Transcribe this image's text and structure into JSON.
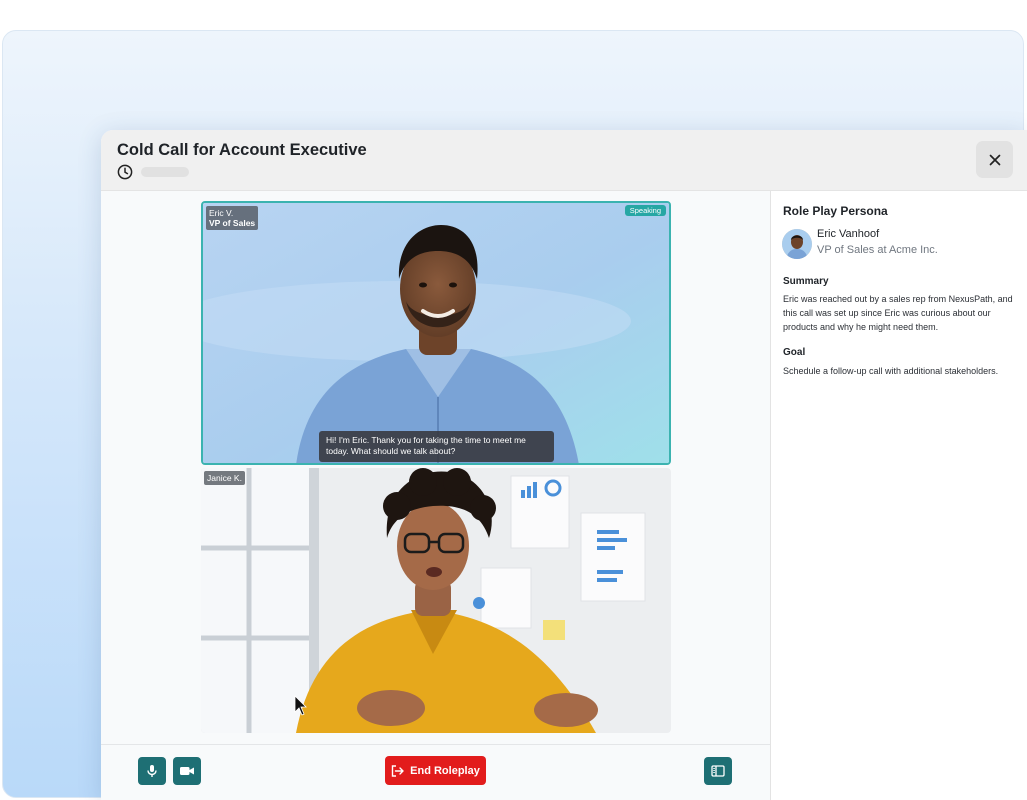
{
  "header": {
    "title": "Cold Call for Account Executive"
  },
  "tiles": {
    "eric": {
      "name": "Eric V.",
      "role": "VP of Sales",
      "status": "Speaking",
      "caption": "Hi! I'm Eric. Thank you for taking the time to meet me today. What should we talk about?"
    },
    "janice": {
      "name": "Janice K."
    }
  },
  "controls": {
    "end_label": "End Roleplay"
  },
  "sidebar": {
    "title": "Role Play Persona",
    "persona": {
      "name": "Eric Vanhoof",
      "role": "VP of Sales at Acme Inc."
    },
    "summary": {
      "heading": "Summary",
      "text": "Eric was reached out by a sales rep from NexusPath, and this call was set up since Eric was curious about our products and why he might need them."
    },
    "goal": {
      "heading": "Goal",
      "text": "Schedule a follow-up call with additional stakeholders."
    }
  },
  "colors": {
    "accent": "#1e6f74",
    "danger": "#e21c1c",
    "speaking": "#26a7a4"
  },
  "icons": [
    "clock-icon",
    "close-icon",
    "microphone-icon",
    "video-camera-icon",
    "exit-icon",
    "sidebar-panel-icon",
    "cursor-icon"
  ]
}
